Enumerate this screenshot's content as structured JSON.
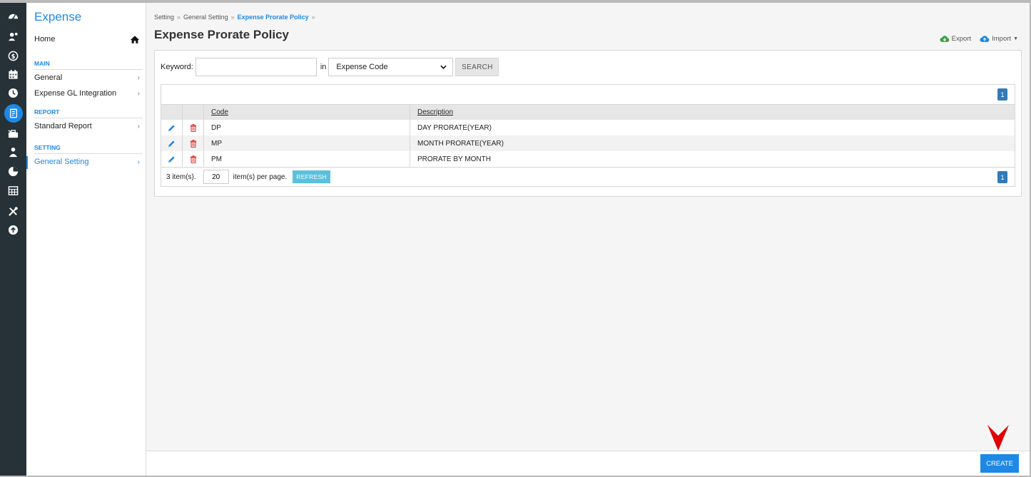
{
  "rail": {
    "icons": [
      "dashboard-icon",
      "employee-icon",
      "payroll-icon",
      "calendar-icon",
      "clock-icon",
      "expense-icon",
      "travel-icon",
      "user-group-icon",
      "chart-icon",
      "table-icon",
      "tools-icon",
      "upload-icon"
    ],
    "active_index": 5
  },
  "menu": {
    "title": "Expense",
    "home_label": "Home",
    "sections": [
      {
        "heading": "MAIN",
        "items": [
          "General",
          "Expense GL Integration"
        ]
      },
      {
        "heading": "REPORT",
        "items": [
          "Standard Report"
        ]
      },
      {
        "heading": "SETTING",
        "items": [
          "General Setting"
        ]
      }
    ],
    "active_item": "General Setting"
  },
  "breadcrumb": {
    "items": [
      "Setting",
      "General Setting",
      "Expense Prorate Policy"
    ],
    "separator": "»"
  },
  "page": {
    "title": "Expense Prorate Policy",
    "export_label": "Export",
    "import_label": "Import"
  },
  "search": {
    "keyword_label": "Keyword:",
    "keyword_value": "",
    "in_label": "in",
    "field_selected": "Expense Code",
    "button_label": "SEARCH"
  },
  "grid": {
    "columns": [
      "Code",
      "Description"
    ],
    "rows": [
      {
        "code": "DP",
        "description": "DAY PRORATE(YEAR)"
      },
      {
        "code": "MP",
        "description": "MONTH PRORATE(YEAR)"
      },
      {
        "code": "PM",
        "description": "PRORATE BY MONTH"
      }
    ],
    "page_number": "1",
    "item_count_text": "3 item(s).",
    "per_page_value": "20",
    "per_page_label": "item(s) per page.",
    "refresh_label": "REFRESH"
  },
  "footer": {
    "create_label": "CREATE"
  },
  "colors": {
    "accent": "#1e88e5",
    "rail": "#263238",
    "delete": "#e53935",
    "export": "#43a047",
    "hint_arrow": "#e00000"
  }
}
